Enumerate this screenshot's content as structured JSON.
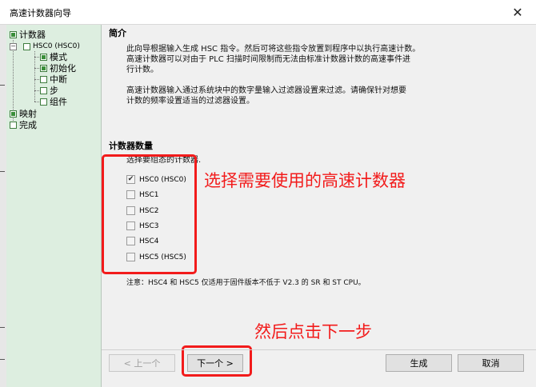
{
  "window": {
    "title": "高速计数器向导",
    "close_glyph": "✕"
  },
  "tree": {
    "counter": "计数器",
    "hsc0": "HSC0 (HSC0)",
    "mode": "模式",
    "init": "初始化",
    "interrupt": "中断",
    "step": "步",
    "component": "组件",
    "mapping": "映射",
    "complete": "完成"
  },
  "intro": {
    "title": "简介",
    "line1": "此向导根据输入生成 HSC 指令。然后可将这些指令放置到程序中以执行高速计数。",
    "line2": "高速计数器可以对由于 PLC 扫描时间限制而无法由标准计数器计数的高速事件进",
    "line3": "行计数。",
    "line4": "高速计数器输入通过系统块中的数字量输入过滤器设置来过滤。请确保针对想要",
    "line5": "计数的频率设置适当的过滤器设置。"
  },
  "counters": {
    "title": "计数器数量",
    "prompt": "选择要组态的计数器.",
    "items": [
      {
        "label": "HSC0 (HSC0)",
        "mark": "✔"
      },
      {
        "label": "HSC1",
        "mark": ""
      },
      {
        "label": "HSC2",
        "mark": ""
      },
      {
        "label": "HSC3",
        "mark": ""
      },
      {
        "label": "HSC4",
        "mark": ""
      },
      {
        "label": "HSC5 (HSC5)",
        "mark": ""
      }
    ],
    "note": "注意：HSC4 和 HSC5 仅适用于固件版本不低于 V2.3 的 SR 和 ST CPU。"
  },
  "annotations": {
    "select": "选择需要使用的高速计数器",
    "next": "然后点击下一步"
  },
  "buttons": {
    "prev": "< 上一个",
    "next": "下一个 >",
    "finish": "生成",
    "cancel": "取消"
  }
}
